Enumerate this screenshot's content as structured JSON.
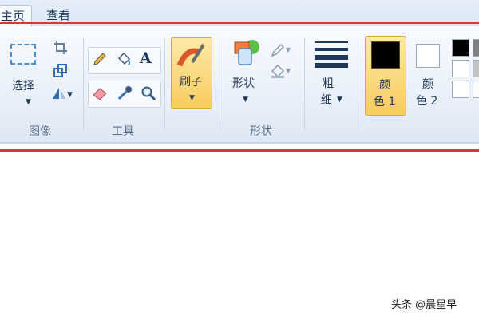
{
  "tabs": [
    {
      "label": "主页",
      "active": true
    },
    {
      "label": "查看",
      "active": false
    }
  ],
  "groups": {
    "image": {
      "label": "图像",
      "select_label": "选择",
      "icons": [
        "select-rectangle-icon",
        "crop-icon",
        "resize-icon",
        "rotate-icon"
      ]
    },
    "tools": {
      "label": "工具",
      "icons": [
        "pencil-icon",
        "fill-bucket-icon",
        "text-icon",
        "eraser-icon",
        "color-picker-icon",
        "magnifier-icon"
      ]
    },
    "brushes": {
      "label": "刷子"
    },
    "shapes": {
      "label": "形状",
      "button_label": "形状",
      "icons": [
        "shapes-icon",
        "outline-icon",
        "fill-icon"
      ]
    },
    "size": {
      "label_line1": "粗",
      "label_line2": "细"
    },
    "colors": {
      "color1_line1": "颜",
      "color1_line2": "色 1",
      "color2_line1": "颜",
      "color2_line2": "色 2",
      "color1_value": "#000000",
      "color2_value": "#ffffff",
      "palette": [
        "#000000",
        "#7f7f7f",
        "#ffffff",
        "#c3c3c3",
        "#ffffff",
        "#ffffff"
      ]
    }
  },
  "watermark": "头条 @晨星早",
  "accent_colors": {
    "highlight_line": "#d5383d",
    "selected_button": "#f8cc5e"
  }
}
